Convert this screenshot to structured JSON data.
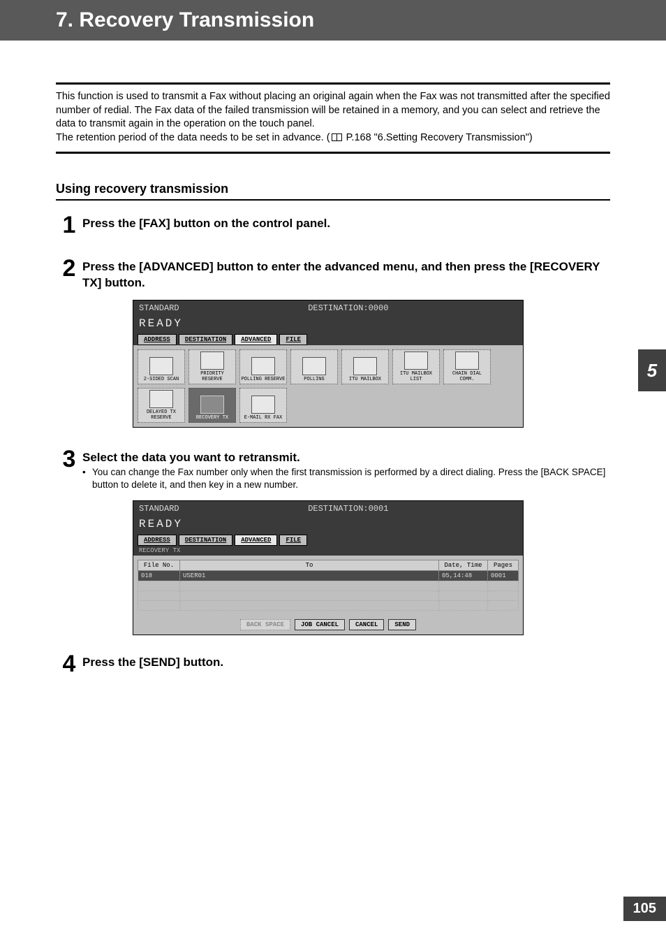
{
  "header": {
    "title": "7. Recovery Transmission"
  },
  "side_tab": "5",
  "page_number": "105",
  "intro": {
    "text": "This function is used to transmit a Fax without placing an original again when the Fax was not transmitted after the specified number of redial. The Fax data of the failed transmission will be retained in a memory, and you can select and retrieve the data to transmit again in the operation on the touch panel.",
    "retention_prefix": "The retention period of the data needs to be set in advance. (",
    "retention_ref": " P.168 \"6.Setting Recovery Transmission\")"
  },
  "section_heading": "Using recovery transmission",
  "steps": {
    "s1": {
      "num": "1",
      "title": "Press the [FAX] button on the control panel."
    },
    "s2": {
      "num": "2",
      "title": "Press the [ADVANCED] button to enter the advanced menu, and then press the [RECOVERY TX] button."
    },
    "s3": {
      "num": "3",
      "title": "Select the data you want to retransmit.",
      "note": "You can change the Fax number only when the first transmission is performed by a direct dialing. Press the [BACK SPACE] button to delete it, and then key in a new number."
    },
    "s4": {
      "num": "4",
      "title": "Press the [SEND] button."
    }
  },
  "lcd1": {
    "standard": "STANDARD",
    "dest": "DESTINATION:0000",
    "ready": "READY",
    "tabs": {
      "address": "ADDRESS",
      "destination": "DESTINATION",
      "advanced": "ADVANCED",
      "file": "FILE"
    },
    "buttons": {
      "b0": "2-SIDED SCAN",
      "b1": "PRIORITY RESERVE",
      "b2": "POLLING RESERVE",
      "b3": "POLLING",
      "b4": "ITU MAILBOX",
      "b5": "ITU MAILBOX LIST",
      "b6": "CHAIN DIAL COMM.",
      "b7": "DELAYED TX RESERVE",
      "b8": "RECOVERY TX",
      "b9": "E-MAIL RX FAX"
    }
  },
  "lcd2": {
    "standard": "STANDARD",
    "dest": "DESTINATION:0001",
    "ready": "READY",
    "sublabel": "RECOVERY TX",
    "tabs": {
      "address": "ADDRESS",
      "destination": "DESTINATION",
      "advanced": "ADVANCED",
      "file": "FILE"
    },
    "headers": {
      "fileno": "File No.",
      "to": "To",
      "datetime": "Date, Time",
      "pages": "Pages"
    },
    "row": {
      "fileno": "018",
      "to": "USER01",
      "datetime": "05,14:48",
      "pages": "0001"
    },
    "buttons": {
      "backspace": "BACK SPACE",
      "jobcancel": "JOB CANCEL",
      "cancel": "CANCEL",
      "send": "SEND"
    }
  }
}
